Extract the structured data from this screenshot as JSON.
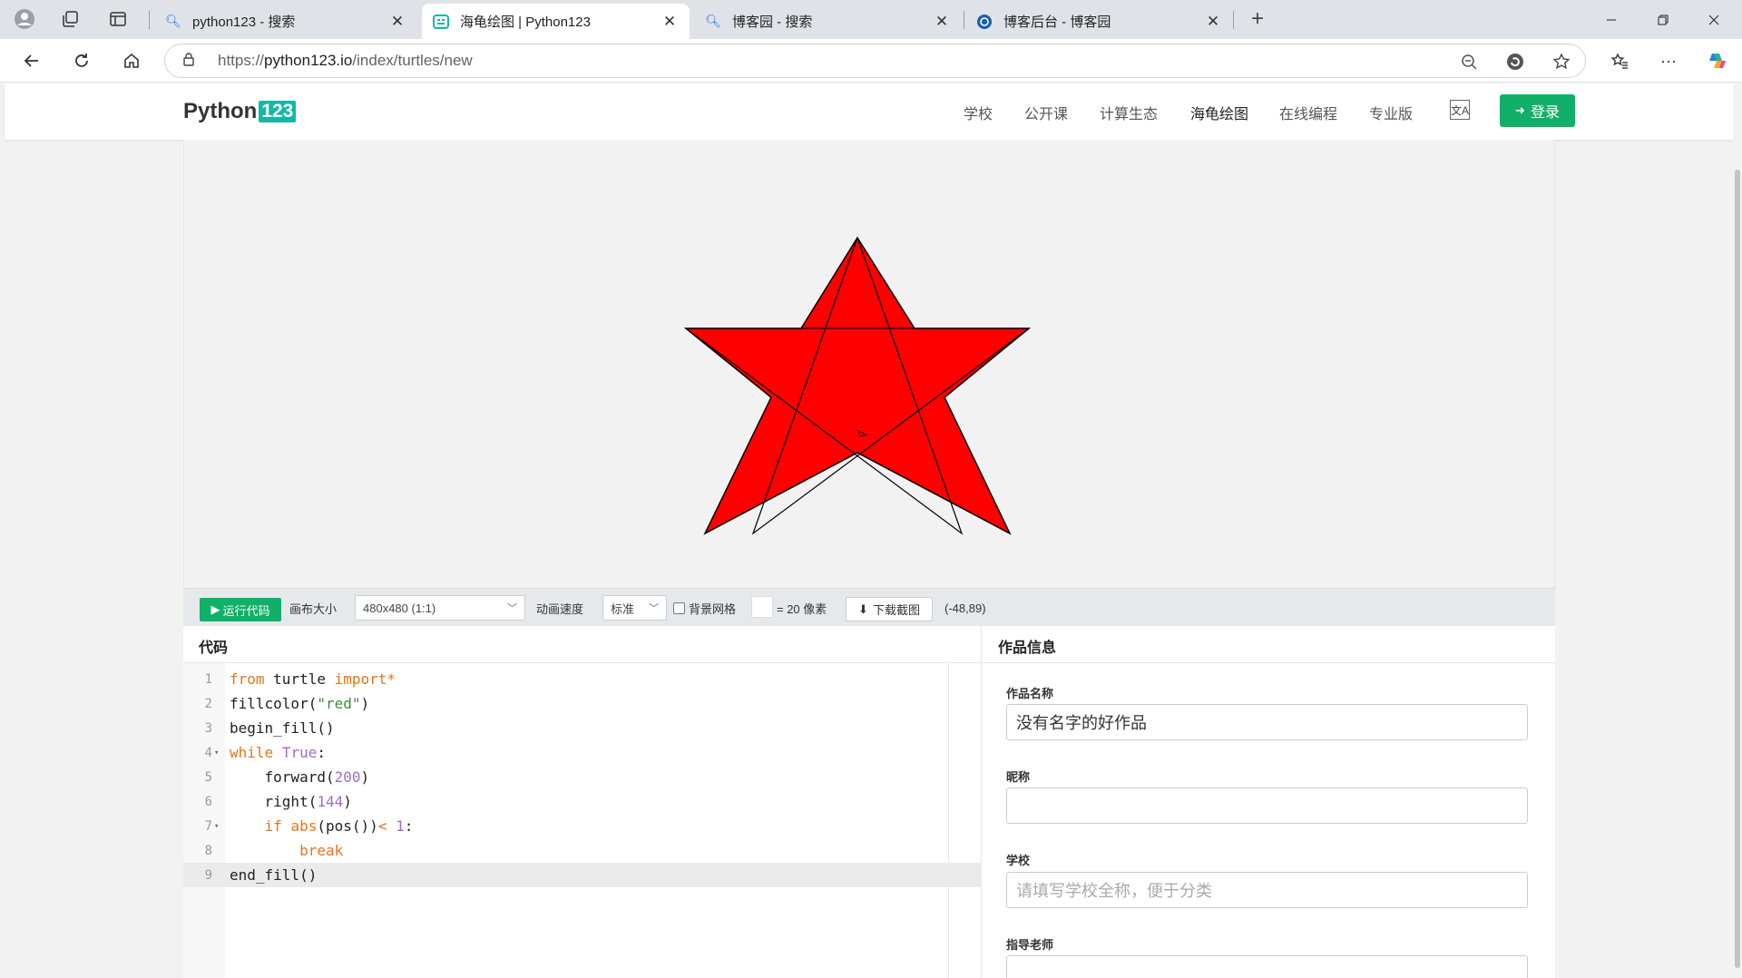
{
  "browser": {
    "tabs": [
      {
        "label": "python123 - 搜索",
        "active": false
      },
      {
        "label": "海龟绘图 | Python123",
        "active": true
      },
      {
        "label": "博客园 - 搜索",
        "active": false
      },
      {
        "label": "博客后台 - 博客园",
        "active": false
      }
    ],
    "url_prefix": "https://",
    "url_host": "python123.io",
    "url_path": "/index/turtles/new"
  },
  "site": {
    "logo_text": "Python",
    "logo_badge": "123",
    "nav": [
      "学校",
      "公开课",
      "计算生态",
      "海龟绘图",
      "在线编程",
      "专业版"
    ],
    "active_nav": "海龟绘图",
    "login_label": "登录"
  },
  "drawing": {
    "fill_color": "#ff0000",
    "stroke_color": "#000000",
    "turtle_color": "#ff0000"
  },
  "toolbar": {
    "run_label": "运行代码",
    "canvas_size_label": "画布大小",
    "canvas_size_value": "480x480 (1:1)",
    "speed_label": "动画速度",
    "speed_value": "标准",
    "grid_label": "背景网格",
    "grid_checked": false,
    "grid_unit": "= 20 像素",
    "download_label": "下载截图",
    "coords": "(-48,89)"
  },
  "code": {
    "title": "代码",
    "lines": [
      {
        "n": "1",
        "fold": "",
        "text": "from turtle import*"
      },
      {
        "n": "2",
        "fold": "",
        "text": "fillcolor(\"red\")"
      },
      {
        "n": "3",
        "fold": "",
        "text": "begin_fill()"
      },
      {
        "n": "4",
        "fold": "▾",
        "text": "while True:"
      },
      {
        "n": "5",
        "fold": "",
        "text": "    forward(200)"
      },
      {
        "n": "6",
        "fold": "",
        "text": "    right(144)"
      },
      {
        "n": "7",
        "fold": "▾",
        "text": "    if abs(pos())< 1:"
      },
      {
        "n": "8",
        "fold": "",
        "text": "        break"
      },
      {
        "n": "9",
        "fold": "",
        "text": "end_fill()"
      }
    ]
  },
  "info": {
    "title": "作品信息",
    "fields": [
      {
        "label": "作品名称",
        "value": "没有名字的好作品",
        "placeholder": ""
      },
      {
        "label": "昵称",
        "value": "",
        "placeholder": ""
      },
      {
        "label": "学校",
        "value": "",
        "placeholder": "请填写学校全称，便于分类"
      },
      {
        "label": "指导老师",
        "value": "",
        "placeholder": ""
      }
    ]
  }
}
